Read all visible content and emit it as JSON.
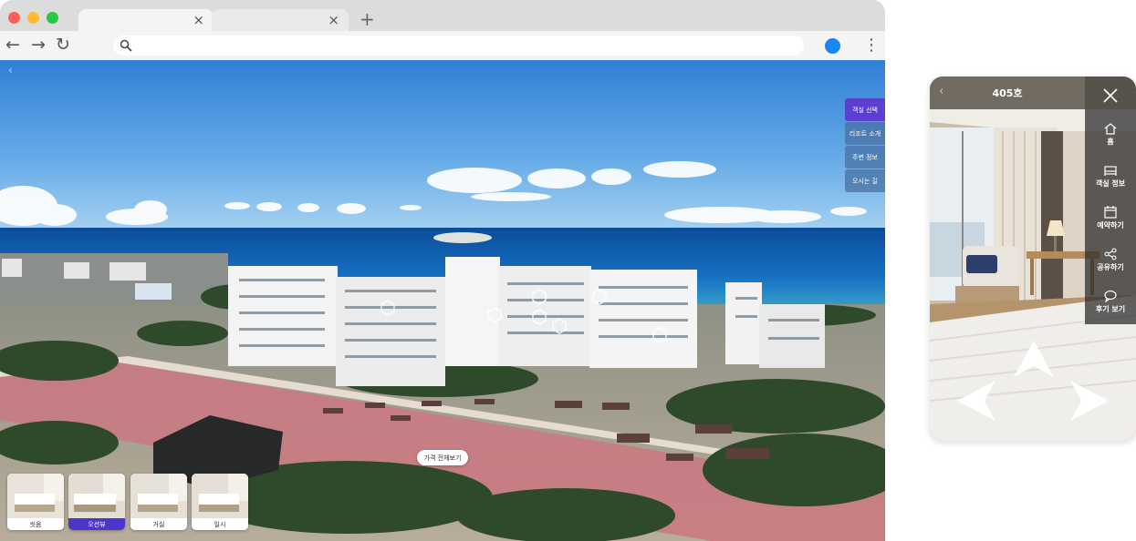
{
  "browser": {
    "tabs": [
      {
        "close_glyph": "×"
      },
      {
        "close_glyph": "×"
      }
    ],
    "new_tab_glyph": "+",
    "nav": {
      "back_glyph": "←",
      "forward_glyph": "→",
      "reload_glyph": "↻",
      "menu_glyph": "⋮"
    },
    "url": "",
    "colors": {
      "close": "#ff5f57",
      "minimize": "#febc2e",
      "maximize": "#28c840",
      "profile": "#1a86f0"
    }
  },
  "viewer": {
    "back_glyph": "‹",
    "side_menu": [
      {
        "label": "객실 선택",
        "active": true
      },
      {
        "label": "리조트 소개",
        "active": false
      },
      {
        "label": "주변 정보",
        "active": false
      },
      {
        "label": "오시는 길",
        "active": false
      }
    ],
    "price_button": "가격 전체보기",
    "room_thumbs": [
      {
        "label": "씻음",
        "active": false
      },
      {
        "label": "오션뷰",
        "active": true
      },
      {
        "label": "거실",
        "active": false
      },
      {
        "label": "일시",
        "active": false
      }
    ],
    "accent_color": "#5b3fd0"
  },
  "phone": {
    "back_glyph": "‹",
    "room_title": "405호",
    "menu": [
      {
        "label": "홈",
        "icon": "home-icon"
      },
      {
        "label": "객실 정보",
        "icon": "bed-icon"
      },
      {
        "label": "예약하기",
        "icon": "calendar-icon"
      },
      {
        "label": "공유하기",
        "icon": "share-icon"
      },
      {
        "label": "후기 보기",
        "icon": "chat-icon"
      }
    ]
  }
}
